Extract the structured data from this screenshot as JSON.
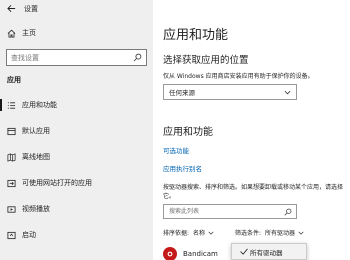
{
  "window": {
    "title": "设置",
    "back_icon": "back-arrow-icon"
  },
  "sidebar": {
    "home_label": "主页",
    "search_placeholder": "查找设置",
    "section_label": "应用",
    "items": [
      {
        "label": "应用和功能",
        "icon": "list-icon",
        "active": true
      },
      {
        "label": "默认应用",
        "icon": "default-apps-icon",
        "active": false
      },
      {
        "label": "离线地图",
        "icon": "map-icon",
        "active": false
      },
      {
        "label": "可使用网站打开的应用",
        "icon": "web-app-icon",
        "active": false
      },
      {
        "label": "视频播放",
        "icon": "video-icon",
        "active": false
      },
      {
        "label": "启动",
        "icon": "startup-icon",
        "active": false
      }
    ]
  },
  "main": {
    "title": "应用和功能",
    "install_heading": "选择获取应用的位置",
    "install_desc": "仅从 Windows 应用商店安装应用有助于保护你的设备。",
    "install_dropdown_value": "任何来源",
    "apps_heading": "应用和功能",
    "link_optional_features": "可选功能",
    "link_app_aliases": "应用执行别名",
    "apps_desc": "按驱动器搜索、排序和筛选。如果想要卸载或移动某个应用，请选择它。",
    "search_placeholder": "搜索此列表",
    "sort_label": "排序依据:",
    "sort_value": "名称",
    "filter_label": "筛选条件:",
    "filter_value": "所有驱动器",
    "filter_popup_option": "所有驱动器",
    "app_name": "Bandicam"
  },
  "colors": {
    "accent": "#0063b1",
    "sidebar_bg": "#efefef",
    "app_icon": "#c41a1a"
  }
}
